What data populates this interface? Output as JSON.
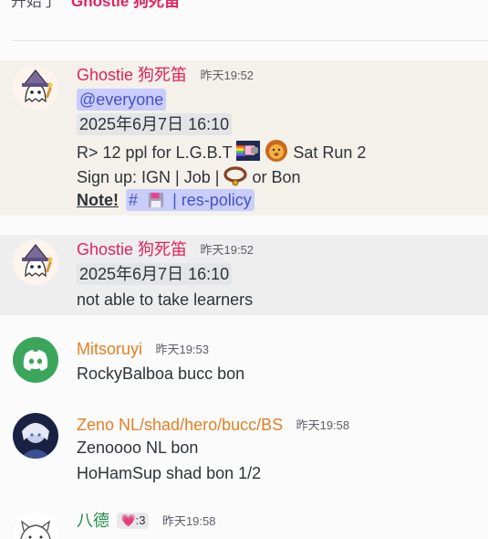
{
  "top": {
    "prefix": "开始了",
    "name": "Ghostie 狗死笛"
  },
  "colors": {
    "ghostie": "#e0245e",
    "orange": "#e67e22",
    "green": "#1f8b4c",
    "mention_bg": "#c9cdfb",
    "mention_fg": "#4752c4",
    "highlight_bg": "#f4f1ea",
    "discord_green": "#3ba55c"
  },
  "messages": [
    {
      "author": "Ghostie 狗死笛",
      "timestamp": "昨天19:52",
      "mention": "@everyone",
      "time_chip": "2025年6月7日 16:10",
      "line_r_a": "R> 12 ppl for L.G.B.T",
      "line_r_b": "Sat Run 2",
      "line_signup_a": "Sign up: IGN | Job |",
      "line_signup_b": "or Bon",
      "note": "Note!",
      "channel_hash": "#",
      "channel_name": "| res-policy",
      "emojis": [
        "nyan-cat-icon",
        "lion-icon",
        "collar-icon",
        "floppy-icon"
      ]
    },
    {
      "author": "Ghostie 狗死笛",
      "timestamp": "昨天19:52",
      "time_chip": "2025年6月7日 16:10",
      "text": "not able to take learners"
    },
    {
      "author": "Mitsoruyi",
      "timestamp": "昨天19:53",
      "text": "RockyBalboa bucc bon",
      "avatar": "discord-logo-icon"
    },
    {
      "author": "Zeno NL/shad/hero/bucc/BS",
      "timestamp": "昨天19:58",
      "line1": "Zenoooo NL bon",
      "line2": "HoHamSup shad bon 1/2"
    },
    {
      "author": "八德",
      "badge": "💗:3",
      "timestamp": "昨天19:58"
    }
  ]
}
